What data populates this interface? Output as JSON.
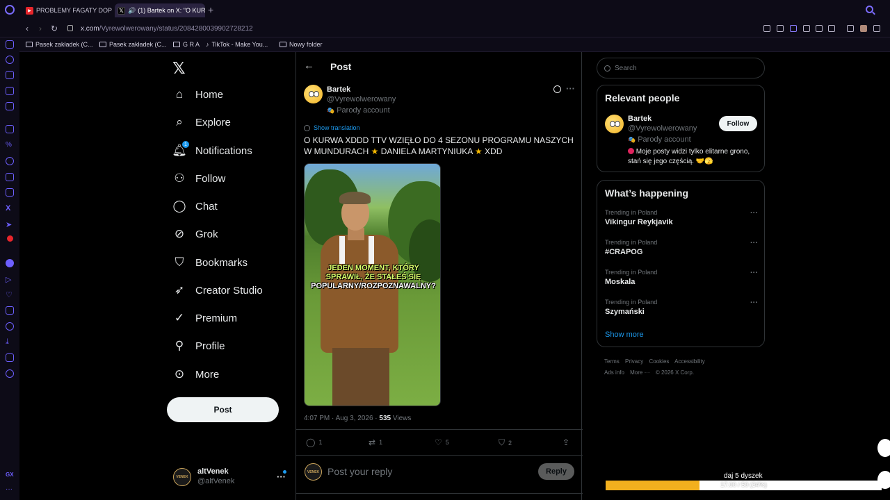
{
  "browser": {
    "tabs": [
      {
        "label": "PROBLEMY FAGATY DOPI"
      },
      {
        "label": "(1) Bartek on X: \"O KUR"
      }
    ],
    "url_host": "x.com",
    "url_path": "/Vyrewolwerowany/status/2084280039902728212",
    "bookmarks": [
      {
        "label": "Pasek zakładek (C..."
      },
      {
        "label": "Pasek zakładek (C..."
      },
      {
        "label": "G R A"
      },
      {
        "label": "TikTok - Make You..."
      },
      {
        "label": "Nowy folder"
      }
    ]
  },
  "nav": {
    "items": [
      {
        "label": "Home",
        "icon": "home-icon"
      },
      {
        "label": "Explore",
        "icon": "search-icon"
      },
      {
        "label": "Notifications",
        "icon": "bell-icon"
      },
      {
        "label": "Follow",
        "icon": "person-add-icon"
      },
      {
        "label": "Chat",
        "icon": "chat-icon"
      },
      {
        "label": "Grok",
        "icon": "grok-icon"
      },
      {
        "label": "Bookmarks",
        "icon": "bookmark-icon"
      },
      {
        "label": "Creator Studio",
        "icon": "rocket-icon"
      },
      {
        "label": "Premium",
        "icon": "verified-icon"
      },
      {
        "label": "Profile",
        "icon": "person-icon"
      },
      {
        "label": "More",
        "icon": "more-circle-icon"
      }
    ],
    "post_label": "Post",
    "account": {
      "name": "altVenek",
      "handle": "@altVenek",
      "avatar_text": "VENEK"
    }
  },
  "post": {
    "header": "Post",
    "author_name": "Bartek",
    "author_handle": "@Vyrewolwerowany",
    "parody_label": "Parody account",
    "show_translation": "Show translation",
    "text_part1": "O KURWA XDDD TTV WZIĘŁO DO 4 SEZONU PROGRAMU NASZYCH W MUNDURACH ",
    "text_part2": " DANIELA MARTYNIUKA ",
    "text_part3": " XDD",
    "media_caption_1": "JEDEN MOMENT, KTÓRY",
    "media_caption_2": "SPRAWIŁ, ŻE STAŁEŚ SIĘ",
    "media_caption_3": "POPULARNY/ROZPOZNAWALNY?",
    "time": "4:07 PM · Aug 3, 2026 · ",
    "views_count": "535",
    "views_label": " Views",
    "replies": "1",
    "reposts": "1",
    "likes": "5",
    "bookmarks": "2",
    "reply_placeholder": "Post your reply",
    "reply_button": "Reply"
  },
  "right": {
    "search_placeholder": "Search",
    "relevant_title": "Relevant people",
    "person": {
      "name": "Bartek",
      "handle": "@Vyrewolwerowany",
      "parody": "Parody account",
      "bio": " Moje posty widzi tylko elitarne grono, stań się jego częścią. 🤝🫣",
      "follow": "Follow"
    },
    "happening_title": "What’s happening",
    "trends": [
      {
        "context": "Trending in Poland",
        "topic": "Vikingur Reykjavik"
      },
      {
        "context": "Trending in Poland",
        "topic": "#CRAPOG"
      },
      {
        "context": "Trending in Poland",
        "topic": "Moskala"
      },
      {
        "context": "Trending in Poland",
        "topic": "Szymański"
      }
    ],
    "show_more": "Show more",
    "footer": [
      "Terms",
      "Privacy",
      "Cookies",
      "Accessibility",
      "Ads info",
      "More ···",
      "© 2026 X Corp."
    ]
  },
  "overlay": {
    "goal_label": "daj 5 dyszek",
    "goal_text": "17.00 / 50 (34%)",
    "goal_progress": 0.34
  },
  "colors": {
    "accent": "#1d9bf0",
    "goal": "#f2b01e",
    "browser_accent": "#6d5fff"
  }
}
